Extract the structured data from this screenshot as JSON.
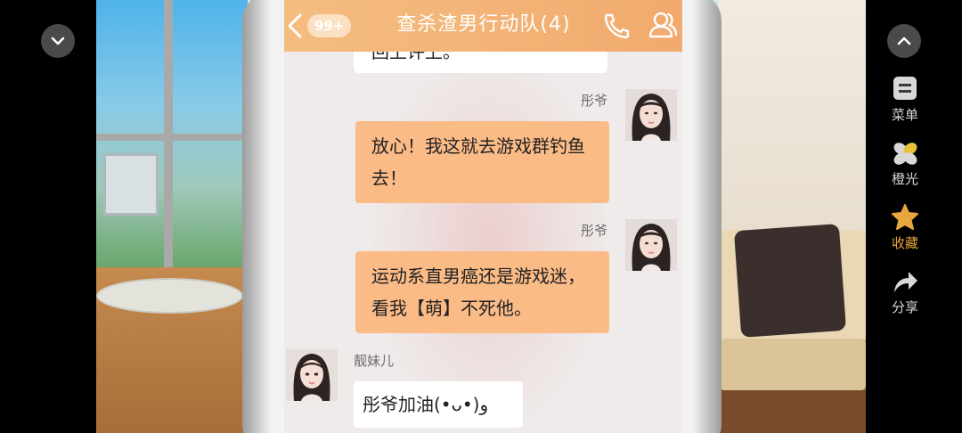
{
  "header": {
    "back_badge": "99+",
    "title": "查杀渣男行动队(4)"
  },
  "side_menu": {
    "items": [
      {
        "label": "菜单",
        "icon": "menu-icon"
      },
      {
        "label": "橙光",
        "icon": "orange-light-icon"
      },
      {
        "label": "收藏",
        "icon": "star-icon",
        "active": true
      },
      {
        "label": "分享",
        "icon": "share-icon"
      }
    ]
  },
  "chat": {
    "prev_text": "回上评上。",
    "messages": [
      {
        "sender": "彤爷",
        "text_line1": "放心！我这就去游戏群钓鱼",
        "text_line2": "去！"
      },
      {
        "sender": "彤爷",
        "text_line1": "运动系直男癌还是游戏迷，",
        "text_line2": "看我【萌】不死他。"
      },
      {
        "sender": "靓妹儿",
        "text_line1": "彤爷加油(•ᴗ•)و"
      }
    ]
  },
  "colors": {
    "title_bar": "#f3b376",
    "bubble_self": "#fbbb87",
    "bubble_other": "#ffffff",
    "active_menu": "#e9a63d"
  }
}
